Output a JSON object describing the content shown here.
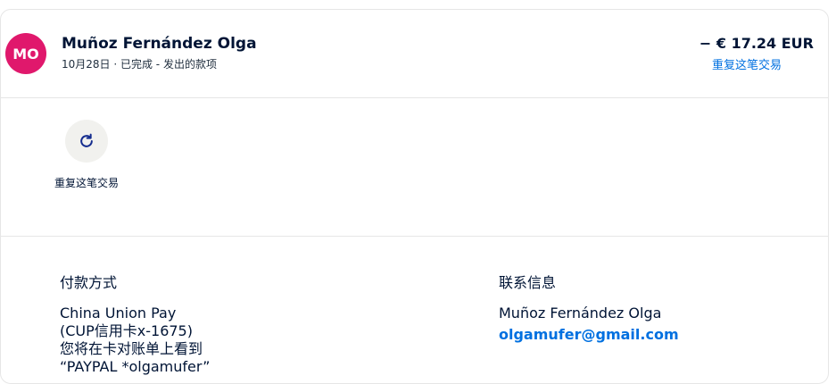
{
  "transaction": {
    "avatar_initials": "MO",
    "name": "Muñoz Fernández Olga",
    "meta": "10月28日 · 已完成 - 发出的款项",
    "amount": "− € 17.24 EUR",
    "repeat_link": "重复这笔交易"
  },
  "actions": {
    "repeat_label": "重复这笔交易",
    "repeat_icon": "refresh-icon"
  },
  "payment": {
    "title": "付款方式",
    "line1": "China Union Pay",
    "line2": "(CUP信用卡x-1675)",
    "line3": "您将在卡对账单上看到",
    "line4": "“PAYPAL *olgamufer”"
  },
  "contact": {
    "title": "联系信息",
    "name": "Muñoz Fernández Olga",
    "email": "olgamufer@gmail.com"
  },
  "colors": {
    "avatar_bg": "#e0186c",
    "link": "#0070e0",
    "text": "#001435"
  }
}
